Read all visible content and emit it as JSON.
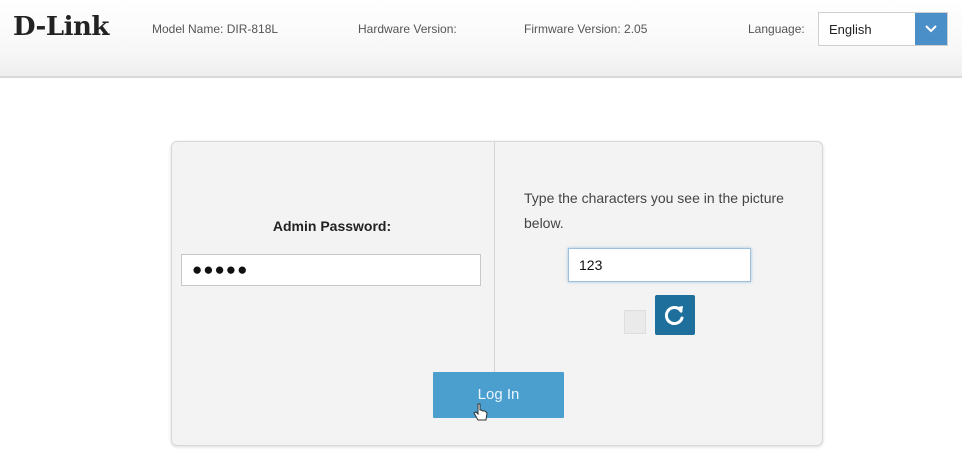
{
  "header": {
    "logo": "D-Link",
    "model_name": "Model Name: DIR-818L",
    "hardware_version": "Hardware Version:",
    "firmware_version": "Firmware Version: 2.05",
    "language_label": "Language:",
    "language_selected": "English",
    "language_arrow_icon": "chevron-down-icon"
  },
  "login": {
    "password_label": "Admin Password:",
    "password_value": "●●●●●",
    "captcha_hint": "Type the characters you see in the picture below.",
    "captcha_value": "123",
    "refresh_icon": "refresh-icon",
    "login_button": "Log In"
  },
  "colors": {
    "accent": "#4b8fc9",
    "refresh": "#1f6f9d",
    "login_button": "#4b9fcf"
  }
}
